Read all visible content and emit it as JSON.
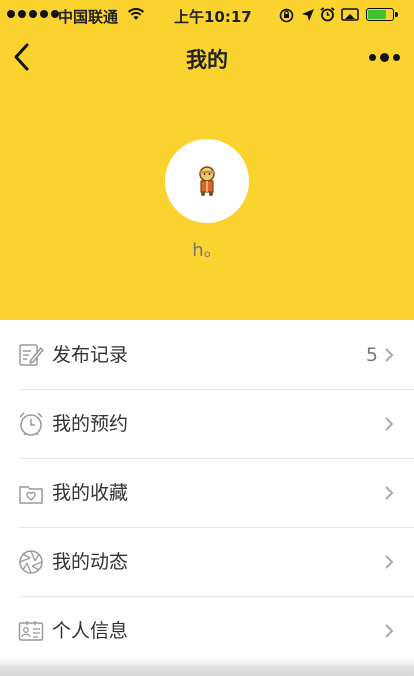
{
  "status_bar": {
    "carrier": "中国联通",
    "time": "上午10:17",
    "signal_bars": 5,
    "battery_level": 0.76,
    "icons": [
      "signal-dots-icon",
      "wifi-icon",
      "orientation-lock-icon",
      "location-arrow-icon",
      "alarm-icon",
      "screen-mirroring-icon",
      "battery-icon"
    ]
  },
  "nav": {
    "title": "我的",
    "back_icon": "back-chevron-icon",
    "more_icon": "more-dots-icon"
  },
  "profile": {
    "username": "h。",
    "avatar_icon": "monkey-avatar-icon"
  },
  "colors": {
    "header": "#fbd32f",
    "battery": "#41c22e",
    "text": "#333333",
    "muted": "#777777"
  },
  "menu": [
    {
      "label": "发布记录",
      "count": "5",
      "icon": "edit-icon"
    },
    {
      "label": "我的预约",
      "count": "",
      "icon": "alarm-clock-icon"
    },
    {
      "label": "我的收藏",
      "count": "",
      "icon": "heart-folder-icon"
    },
    {
      "label": "我的动态",
      "count": "",
      "icon": "aperture-icon"
    },
    {
      "label": "个人信息",
      "count": "",
      "icon": "id-card-icon"
    }
  ]
}
